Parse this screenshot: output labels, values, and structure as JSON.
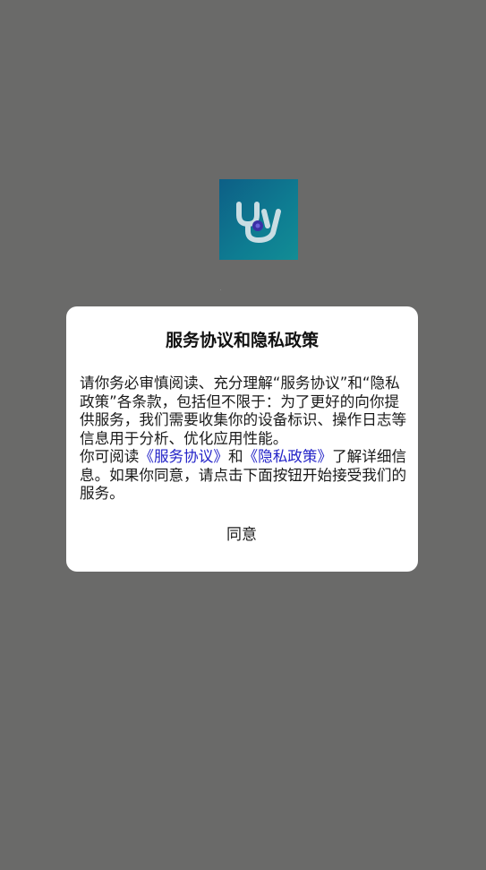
{
  "app": {
    "logo_icon": "stethoscope-icon",
    "logo_colors": [
      "#0d5f86",
      "#128d95"
    ]
  },
  "dialog": {
    "title": "服务协议和隐私政策",
    "paragraph1": "请你务必审慎阅读、充分理解“服务协议”和“隐私政策”各条款，包括但不限于：为了更好的向你提供服务，我们需要收集你的设备标识、操作日志等信息用于分析、优化应用性能。",
    "paragraph2_prefix": "你可阅读",
    "terms_link": "《服务协议》",
    "paragraph2_and": "和",
    "privacy_link": "《隐私政策》",
    "paragraph2_suffix": "了解详细信息。如果你同意，请点击下面按钮开始接受我们的服务。",
    "agree_label": "同意",
    "link_color": "#2323c8"
  }
}
